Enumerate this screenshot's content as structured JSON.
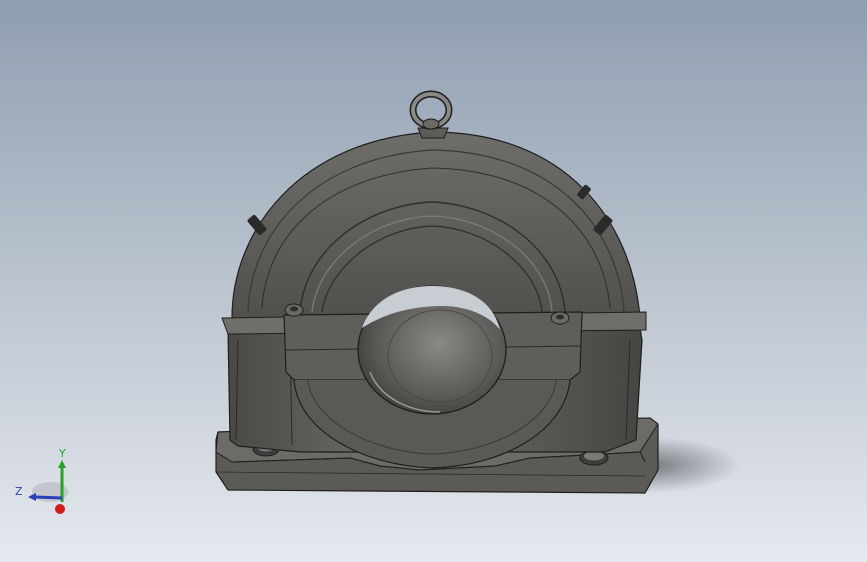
{
  "viewport": {
    "background_top": "#8f9eb0",
    "background_bottom": "#e6e9ee"
  },
  "model": {
    "body_color": "#5d5c59",
    "highlight_color": "#7a7976",
    "shadow_color": "#3e3d3b",
    "edge_color": "#1e1e1e"
  },
  "triad": {
    "x_color": "#d11a1a",
    "y_color": "#2aa02a",
    "z_color": "#2a3fb8",
    "labels": {
      "y": "Y",
      "z": "Z"
    }
  }
}
